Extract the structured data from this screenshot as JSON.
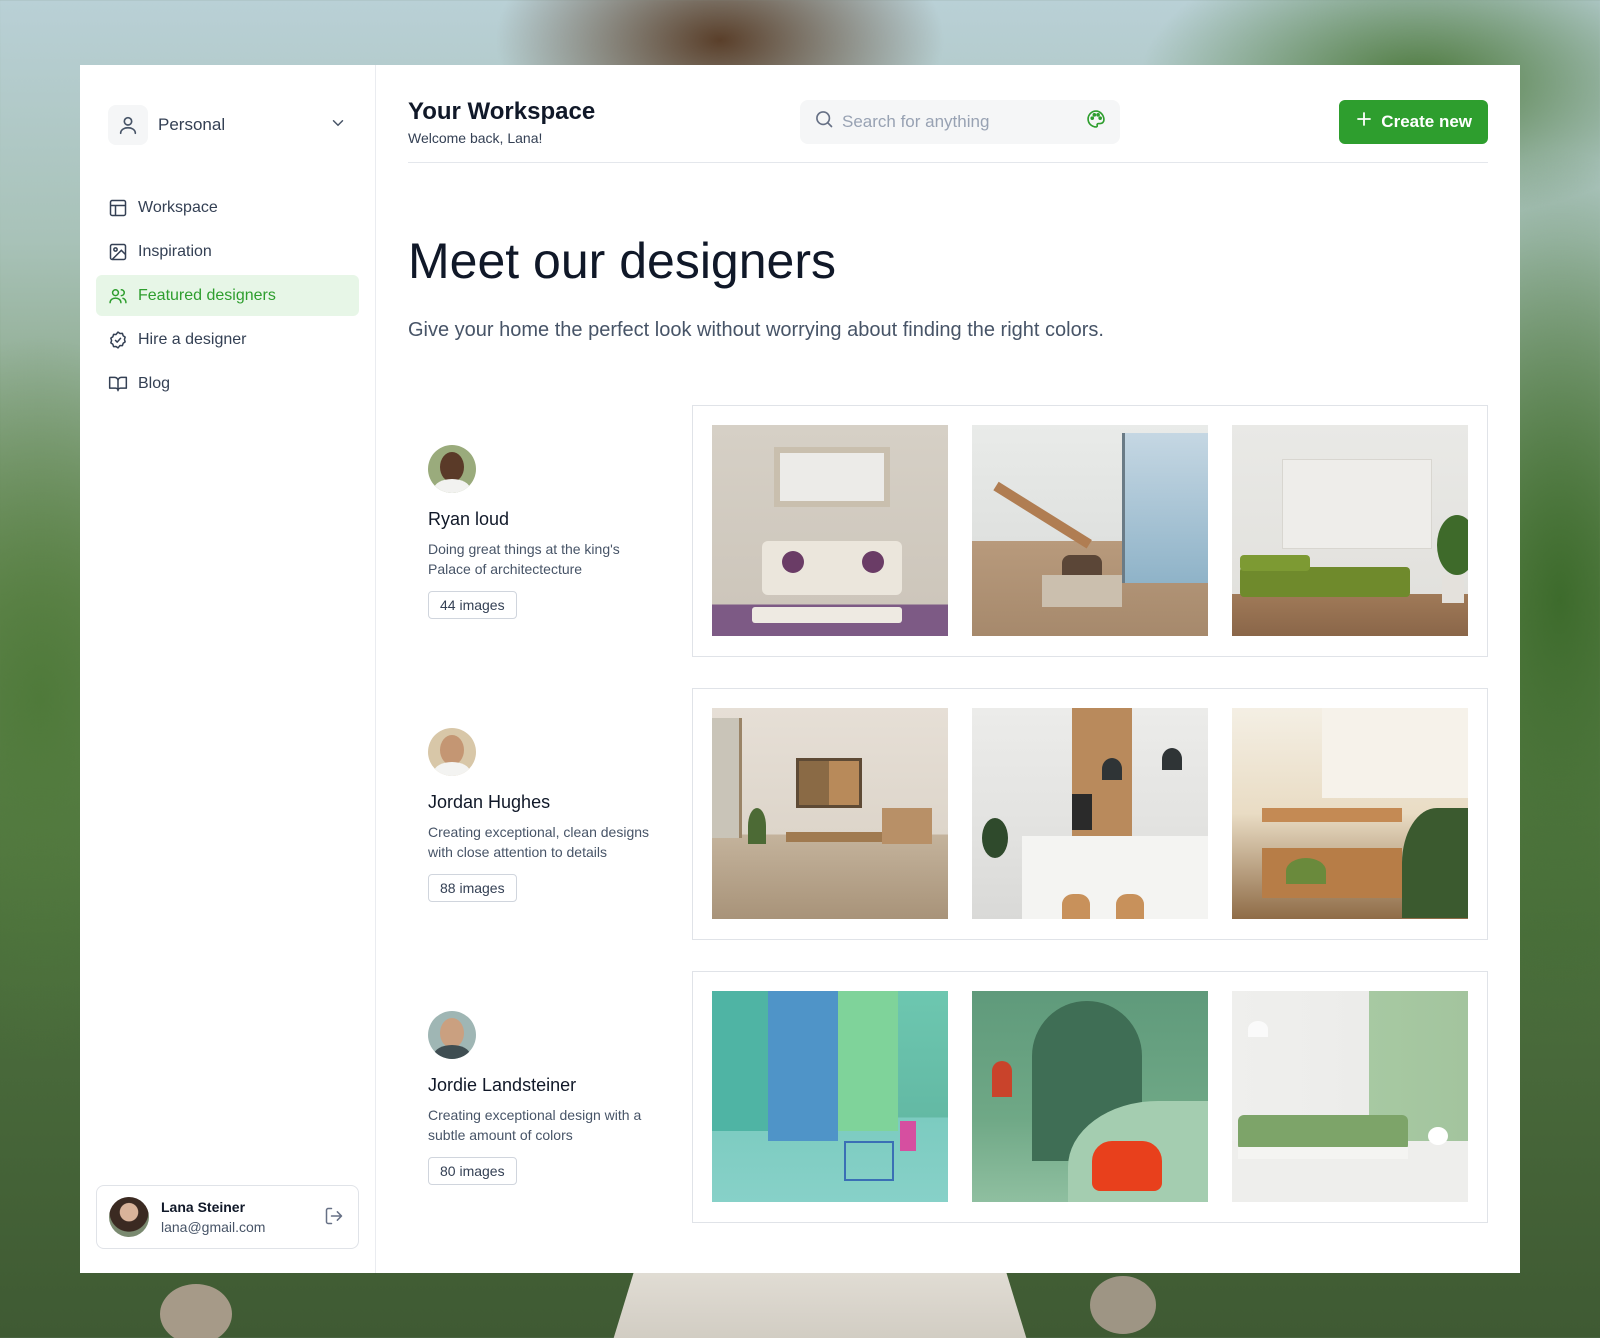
{
  "sidebar": {
    "account_label": "Personal",
    "nav": [
      {
        "label": "Workspace",
        "icon": "layout-icon",
        "active": false
      },
      {
        "label": "Inspiration",
        "icon": "image-icon",
        "active": false
      },
      {
        "label": "Featured designers",
        "icon": "users-icon",
        "active": true
      },
      {
        "label": "Hire a designer",
        "icon": "badge-check-icon",
        "active": false
      },
      {
        "label": "Blog",
        "icon": "book-open-icon",
        "active": false
      }
    ],
    "user": {
      "name": "Lana Steiner",
      "email": "lana@gmail.com"
    }
  },
  "header": {
    "title": "Your Workspace",
    "subtitle": "Welcome back, Lana!",
    "search_placeholder": "Search for anything",
    "create_label": "Create new"
  },
  "hero": {
    "title": "Meet our designers",
    "subtitle": "Give your home the perfect look without worrying about finding the right colors."
  },
  "designers": [
    {
      "name": "Ryan loud",
      "description": "Doing great things at the king's Palace of architectecture",
      "images": "44 images"
    },
    {
      "name": "Jordan Hughes",
      "description": "Creating exceptional, clean designs with close attention to details",
      "images": "88 images"
    },
    {
      "name": "Jordie Landsteiner",
      "description": "Creating exceptional design with a subtle amount of colors",
      "images": "80 images"
    }
  ],
  "colors": {
    "accent": "#2e9e2e",
    "active_bg": "#e7f6e7"
  }
}
